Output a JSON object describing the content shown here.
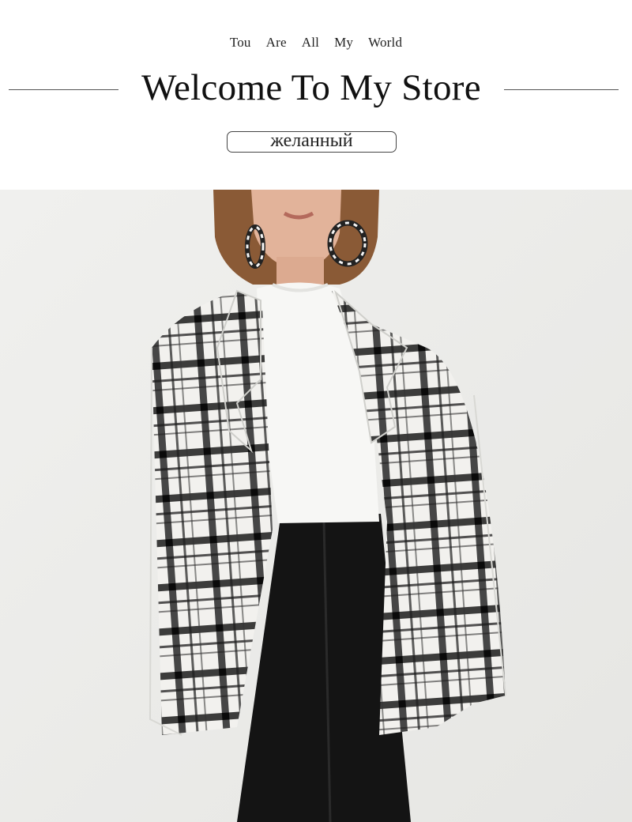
{
  "header": {
    "tagline": [
      "Tou",
      "Are",
      "All",
      "My",
      "World"
    ],
    "title": "Welcome To My Store",
    "badge": "желанный"
  },
  "photo": {
    "subject": "product-photo",
    "colors": {
      "background": "#ececea",
      "jacket_base": "#f2f1ee",
      "plaid_dark": "#1c1c1c",
      "turtleneck": "#f7f7f5",
      "trousers": "#141414",
      "skin": "#e2b39a",
      "hair": "#8a5a36"
    }
  }
}
